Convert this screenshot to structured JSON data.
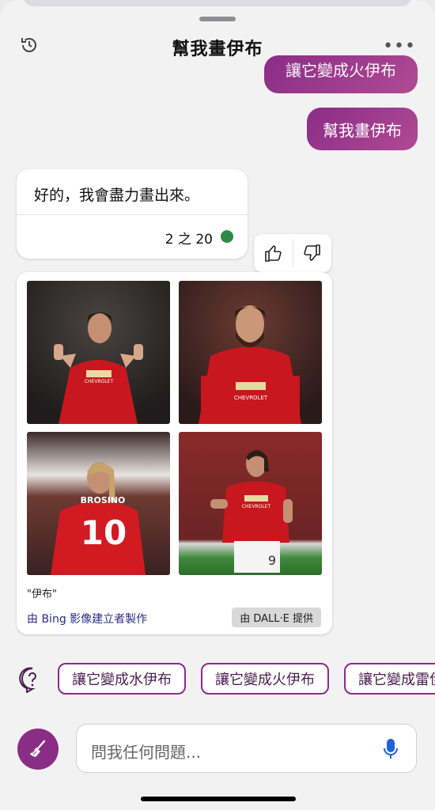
{
  "header": {
    "title": "幫我畫伊布",
    "more_label": "•••"
  },
  "messages": {
    "user_partial": "讓它變成火伊布",
    "user_main": "幫我畫伊布",
    "bot_text": "好的，我會盡力畫出來。",
    "bot_count": "2 之 20"
  },
  "images": {
    "caption": "\"伊布\"",
    "credit": "由 Bing 影像建立者製作",
    "provider": "由 DALL·E 提供",
    "items": [
      {
        "shirt_text": "CHEVROLET"
      },
      {
        "shirt_text": "CHEVROLET"
      },
      {
        "shirt_text": "BROSINO",
        "number": "10"
      },
      {
        "shirt_text": "CHEVROLET",
        "shorts_number": "9"
      }
    ]
  },
  "suggestions": [
    "讓它變成水伊布",
    "讓它變成火伊布",
    "讓它變成雷伊布"
  ],
  "composer": {
    "placeholder": "問我任何問題..."
  },
  "colors": {
    "accent": "#8a2d86",
    "count_dot": "#2e8b47",
    "credit_text": "#2b2b8a"
  }
}
